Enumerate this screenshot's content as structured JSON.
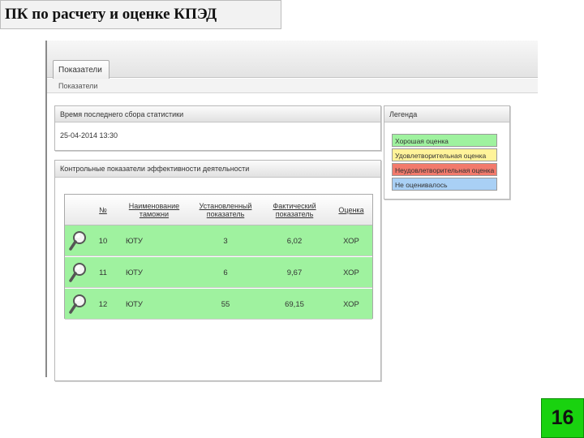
{
  "slide": {
    "title": "ПК по расчету и оценке КПЭД",
    "page_number": "16"
  },
  "app": {
    "tab_label": "Показатели",
    "breadcrumb": "Показатели"
  },
  "stats_panel": {
    "title": "Время последнего сбора статистики",
    "value": "25-04-2014 13:30"
  },
  "legend_panel": {
    "title": "Легенда",
    "items": [
      {
        "label": "Хорошая оценка",
        "color": "#9ff29f"
      },
      {
        "label": "Удовлетворительная оценка",
        "color": "#fff39a"
      },
      {
        "label": "Неудовлетворительная оценка",
        "color": "#f27a6c"
      },
      {
        "label": "Не оценивалось",
        "color": "#a9d0f5"
      }
    ]
  },
  "kpi_panel": {
    "title": "Контрольные показатели эффективности деятельности",
    "columns": {
      "number": "№",
      "customs": "Наименование таможни",
      "target": "Установленный показатель",
      "actual": "Фактический показатель",
      "rating": "Оценка"
    },
    "rows": [
      {
        "number": "10",
        "customs": "ЮТУ",
        "target": "3",
        "actual": "6,02",
        "rating": "ХОР",
        "icon": "magnifier-icon"
      },
      {
        "number": "11",
        "customs": "ЮТУ",
        "target": "6",
        "actual": "9,67",
        "rating": "ХОР",
        "icon": "magnifier-icon"
      },
      {
        "number": "12",
        "customs": "ЮТУ",
        "target": "55",
        "actual": "69,15",
        "rating": "ХОР",
        "icon": "magnifier-icon"
      }
    ]
  }
}
